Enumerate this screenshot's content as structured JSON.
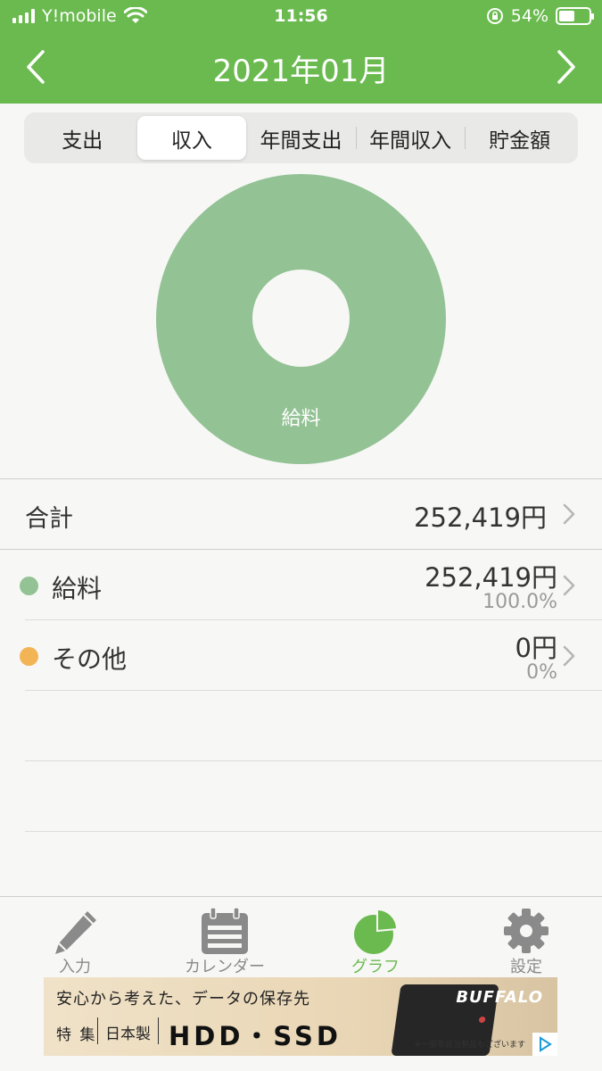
{
  "status_bar": {
    "carrier": "Y!mobile",
    "time": "11:56",
    "battery": "54%",
    "battery_level": 0.54
  },
  "header": {
    "title": "2021年01月"
  },
  "tabs": [
    {
      "label": "支出",
      "active": false
    },
    {
      "label": "収入",
      "active": true
    },
    {
      "label": "年間支出",
      "active": false
    },
    {
      "label": "年間収入",
      "active": false
    },
    {
      "label": "貯金額",
      "active": false
    }
  ],
  "chart_data": {
    "type": "pie",
    "categories": [
      "給料"
    ],
    "values": [
      100
    ],
    "colors": [
      "#93c294"
    ]
  },
  "summary": {
    "total_label": "合計",
    "total_amount": "252,419円"
  },
  "rows": [
    {
      "name": "給料",
      "amount": "252,419円",
      "percent": "100.0%",
      "color": "#93c294"
    },
    {
      "name": "その他",
      "amount": "0円",
      "percent": "0%",
      "color": "#f2b455"
    }
  ],
  "tabbar": [
    {
      "label": "入力",
      "icon": "pencil-icon",
      "active": false
    },
    {
      "label": "カレンダー",
      "icon": "calendar-icon",
      "active": false
    },
    {
      "label": "グラフ",
      "icon": "pie-chart-icon",
      "active": true
    },
    {
      "label": "設定",
      "icon": "gear-icon",
      "active": false
    }
  ],
  "ad": {
    "headline": "安心から考えた、データの保存先",
    "feature": "特 集",
    "made_in": "日本製",
    "product": "HDD・SSD",
    "brand": "BUFFALO",
    "disclaimer": "※一部非該当製品もございます"
  },
  "colors": {
    "accent": "#6aba4f",
    "salary": "#93c294",
    "other": "#f2b455"
  }
}
